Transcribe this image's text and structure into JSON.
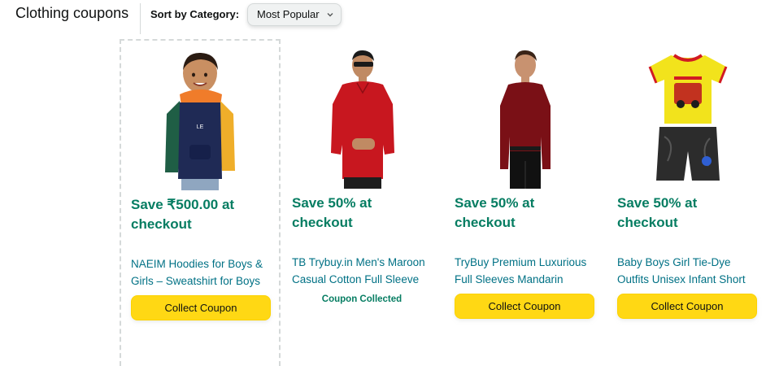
{
  "header": {
    "title": "Clothing coupons",
    "sort_label": "Sort by Category:",
    "sort_value": "Most Popular"
  },
  "cards": [
    {
      "promo_line1": "Save ₹500.00 at",
      "promo_line2": "checkout",
      "product_line1": "NAEIM Hoodies for Boys &",
      "product_line2": "Girls – Sweatshirt for Boys",
      "action": "Collect Coupon"
    },
    {
      "promo_line1": "Save 50% at",
      "promo_line2": "checkout",
      "product_line1": "TB Trybuy.in Men's Maroon",
      "product_line2": "Casual Cotton Full Sleeve",
      "status": "Coupon Collected"
    },
    {
      "promo_line1": "Save 50% at",
      "promo_line2": "checkout",
      "product_line1": "TryBuy Premium Luxurious",
      "product_line2": "Full Sleeves Mandarin",
      "action": "Collect Coupon"
    },
    {
      "promo_line1": "Save 50% at",
      "promo_line2": "checkout",
      "product_line1": "Baby Boys Girl Tie-Dye",
      "product_line2": "Outfits Unisex Infant Short",
      "action": "Collect Coupon"
    }
  ],
  "colors": {
    "promo_green": "#067d62",
    "link_teal": "#007185",
    "button_yellow": "#ffd814"
  },
  "icons": [
    "chevron-down-icon"
  ]
}
